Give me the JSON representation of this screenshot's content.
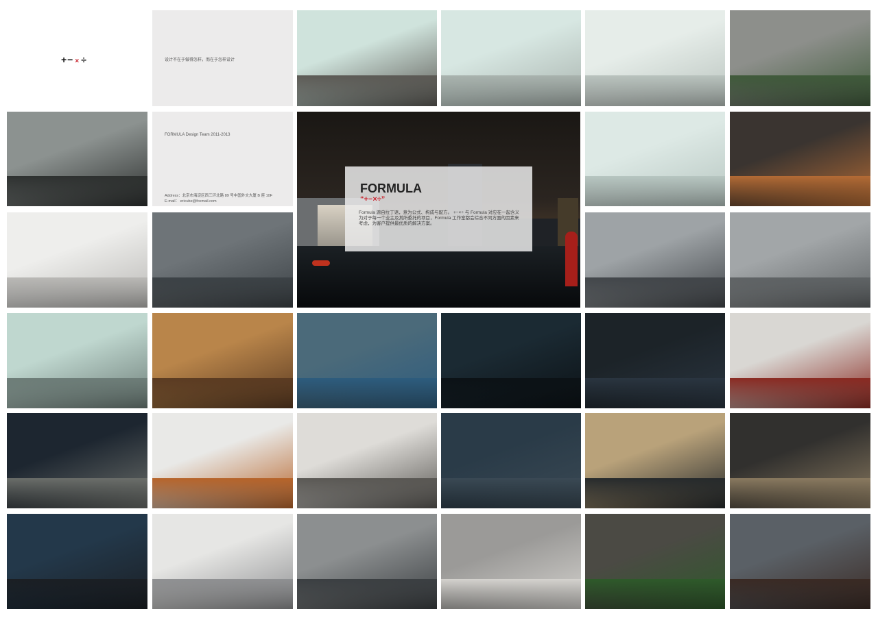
{
  "logo": {
    "part1": "+−",
    "part2": "×",
    "part3": "÷"
  },
  "tagline": "设计不在于做得怎样，而在于怎样设计",
  "team": "FORMULA Design Team 2011-2013",
  "address": "Address：北京市海淀区西三环北路 89 号中国外文大厦 B 座 10F",
  "email": "E-mail：    ericube@foxmail.com",
  "hero": {
    "title": "FORMULA",
    "symbol": "“+−×÷”",
    "body": "Formula 源自拉丁语，意为公式、构成与配方。 +−×÷ 与 Formula 对应在一起含义为对于每一个业主及其所委托的项目，Formula 工作室都会综合不同方面的因素来考虑，为客户提供最优质的解决方案。"
  },
  "colors": {
    "accent_red": "#c8202a",
    "panel_grey": "#ecebeb"
  },
  "tiles_count": 30
}
